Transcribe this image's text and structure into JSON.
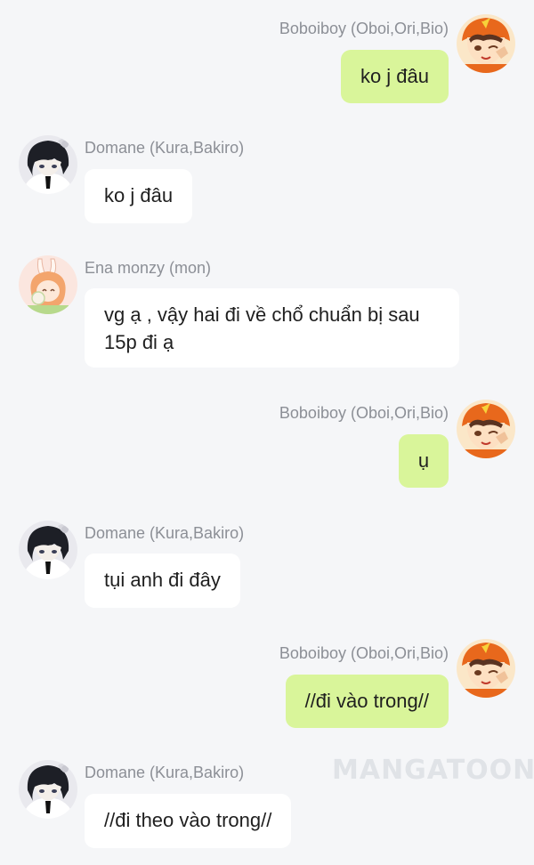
{
  "watermark": "MANGATOON",
  "colors": {
    "background": "#f5f6f8",
    "incoming_bubble": "#ffffff",
    "outgoing_bubble": "#d9f59a",
    "name_text": "#8c8f96"
  },
  "messages": [
    {
      "side": "right",
      "sender": "Boboiboy (Oboi,Ori,Bio)",
      "avatar": "boboiboy-avatar-icon",
      "text": "ko j đâu"
    },
    {
      "side": "left",
      "sender": "Domane (Kura,Bakiro)",
      "avatar": "domane-avatar-icon",
      "text": "ko j đâu"
    },
    {
      "side": "left",
      "sender": "Ena monzy (mon)",
      "avatar": "ena-avatar-icon",
      "text": "vg ạ , vậy hai đi về chổ chuẩn bị sau 15p đi ạ"
    },
    {
      "side": "right",
      "sender": "Boboiboy (Oboi,Ori,Bio)",
      "avatar": "boboiboy-avatar-icon",
      "text": "ụ"
    },
    {
      "side": "left",
      "sender": "Domane (Kura,Bakiro)",
      "avatar": "domane-avatar-icon",
      "text": "tụi anh đi đây"
    },
    {
      "side": "right",
      "sender": "Boboiboy (Oboi,Ori,Bio)",
      "avatar": "boboiboy-avatar-icon",
      "text": "//đi vào trong//"
    },
    {
      "side": "left",
      "sender": "Domane (Kura,Bakiro)",
      "avatar": "domane-avatar-icon",
      "text": "//đi theo vào trong//"
    }
  ]
}
